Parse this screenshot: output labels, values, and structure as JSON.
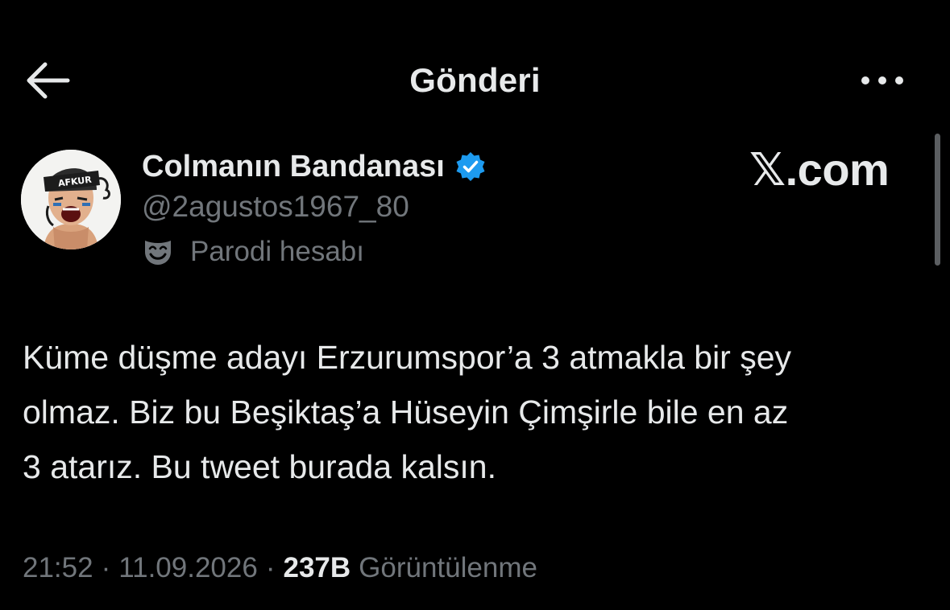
{
  "header": {
    "title": "Gönderi",
    "back_icon": "arrow-left-icon",
    "more_icon": "more-horizontal-icon"
  },
  "author": {
    "display_name": "Colmanın Bandanası",
    "handle": "@2agustos1967_80",
    "verified_icon": "verified-badge-icon",
    "verified_color": "#1d9bf0",
    "parody_label": "Parodi hesabı",
    "parody_icon": "theater-mask-icon",
    "avatar_headband_text": "AFKUR"
  },
  "watermark": "𝕏.com",
  "tweet": {
    "lines": [
      "Küme düşme adayı Erzurumspor’a 3 atmakla bir şey",
      "olmaz. Biz bu Beşiktaş’a Hüseyin Çimşirle bile en az",
      "3 atarız. Bu tweet burada kalsın."
    ]
  },
  "meta": {
    "time": "21:52",
    "separator": "·",
    "date": "11.09.2026",
    "views_count": "237B",
    "views_label": "Görüntülenme"
  },
  "colors": {
    "background": "#000000",
    "primary_text": "#e7e9ea",
    "secondary_text": "#71767b",
    "accent": "#1d9bf0"
  }
}
